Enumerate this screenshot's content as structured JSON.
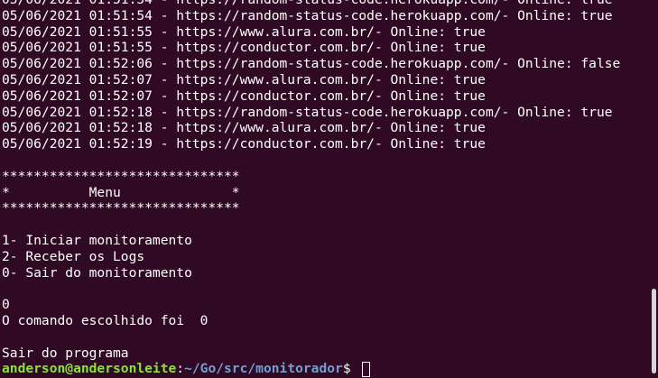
{
  "terminal": {
    "lines": [
      "05/06/2021 01:51:54 - https://random-status-code.herokuapp.com/- Online: true",
      "05/06/2021 01:51:55 - https://www.alura.com.br/- Online: true",
      "05/06/2021 01:51:55 - https://conductor.com.br/- Online: true",
      "05/06/2021 01:52:06 - https://random-status-code.herokuapp.com/- Online: false",
      "05/06/2021 01:52:07 - https://www.alura.com.br/- Online: true",
      "05/06/2021 01:52:07 - https://conductor.com.br/- Online: true",
      "05/06/2021 01:52:18 - https://random-status-code.herokuapp.com/- Online: true",
      "05/06/2021 01:52:18 - https://www.alura.com.br/- Online: true",
      "05/06/2021 01:52:19 - https://conductor.com.br/- Online: true",
      "",
      "******************************",
      "*          Menu              *",
      "******************************",
      "",
      "1- Iniciar monitoramento",
      "2- Receber os Logs",
      "0- Sair do monitoramento",
      "",
      "0",
      "O comando escolhido foi  0",
      "",
      "Sair do programa"
    ],
    "prompt": {
      "user_host": "anderson@andersonleite",
      "separator": ":",
      "path": "~/Go/src/monitorador",
      "symbol": "$ "
    }
  },
  "colors": {
    "background": "#300a24",
    "text": "#ffffff",
    "prompt_user": "#8ae234",
    "prompt_path": "#729fcf"
  }
}
